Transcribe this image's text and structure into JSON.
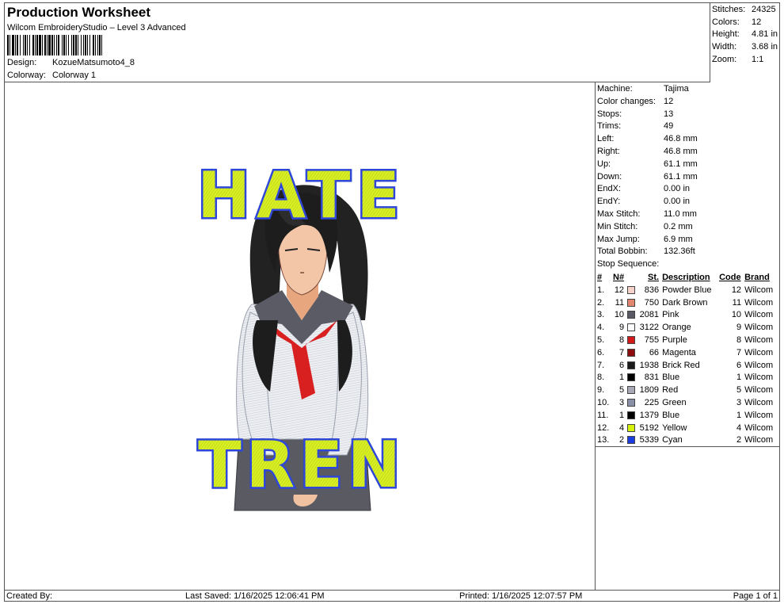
{
  "header": {
    "title": "Production Worksheet",
    "subtitle": "Wilcom EmbroideryStudio – Level 3 Advanced",
    "design_label": "Design:",
    "design_value": "KozueMatsumoto4_8",
    "colorway_label": "Colorway:",
    "colorway_value": "Colorway 1"
  },
  "topstats": [
    {
      "k": "Stitches:",
      "v": "24325"
    },
    {
      "k": "Colors:",
      "v": "12"
    },
    {
      "k": "Height:",
      "v": "4.81 in"
    },
    {
      "k": "Width:",
      "v": "3.68 in"
    },
    {
      "k": "Zoom:",
      "v": "1:1"
    }
  ],
  "design_text": {
    "top": "HATE",
    "bottom": "TREN"
  },
  "info": [
    {
      "k": "Machine:",
      "v": "Tajima"
    },
    {
      "k": "Color changes:",
      "v": "12"
    },
    {
      "k": "Stops:",
      "v": "13"
    },
    {
      "k": "Trims:",
      "v": "49"
    },
    {
      "k": "Left:",
      "v": "46.8 mm"
    },
    {
      "k": "Right:",
      "v": "46.8 mm"
    },
    {
      "k": "Up:",
      "v": "61.1 mm"
    },
    {
      "k": "Down:",
      "v": "61.1 mm"
    },
    {
      "k": "EndX:",
      "v": "0.00 in"
    },
    {
      "k": "EndY:",
      "v": "0.00 in"
    },
    {
      "k": "Max Stitch:",
      "v": "11.0 mm"
    },
    {
      "k": "Min Stitch:",
      "v": "0.2 mm"
    },
    {
      "k": "Max Jump:",
      "v": "6.9 mm"
    },
    {
      "k": "Total Bobbin:",
      "v": "132.36ft"
    }
  ],
  "sequence": {
    "title": "Stop Sequence:",
    "headers": [
      "#",
      "N#",
      "St.",
      "Description",
      "Code",
      "Brand"
    ],
    "rows": [
      {
        "i": "1.",
        "n": "12",
        "color": "#f6d2c8",
        "st": "836",
        "desc": "Powder Blue",
        "code": "12",
        "brand": "Wilcom"
      },
      {
        "i": "2.",
        "n": "11",
        "color": "#e38670",
        "st": "750",
        "desc": "Dark Brown",
        "code": "11",
        "brand": "Wilcom"
      },
      {
        "i": "3.",
        "n": "10",
        "color": "#595964",
        "st": "2081",
        "desc": "Pink",
        "code": "10",
        "brand": "Wilcom"
      },
      {
        "i": "4.",
        "n": "9",
        "color": "#ffffff",
        "st": "3122",
        "desc": "Orange",
        "code": "9",
        "brand": "Wilcom"
      },
      {
        "i": "5.",
        "n": "8",
        "color": "#d31919",
        "st": "755",
        "desc": "Purple",
        "code": "8",
        "brand": "Wilcom"
      },
      {
        "i": "6.",
        "n": "7",
        "color": "#8c0c0c",
        "st": "66",
        "desc": "Magenta",
        "code": "7",
        "brand": "Wilcom"
      },
      {
        "i": "7.",
        "n": "6",
        "color": "#1a1a1a",
        "st": "1938",
        "desc": "Brick Red",
        "code": "6",
        "brand": "Wilcom"
      },
      {
        "i": "8.",
        "n": "1",
        "color": "#000000",
        "st": "831",
        "desc": "Blue",
        "code": "1",
        "brand": "Wilcom"
      },
      {
        "i": "9.",
        "n": "5",
        "color": "#a8a8b6",
        "st": "1809",
        "desc": "Red",
        "code": "5",
        "brand": "Wilcom"
      },
      {
        "i": "10.",
        "n": "3",
        "color": "#8a90a8",
        "st": "225",
        "desc": "Green",
        "code": "3",
        "brand": "Wilcom"
      },
      {
        "i": "11.",
        "n": "1",
        "color": "#000000",
        "st": "1379",
        "desc": "Blue",
        "code": "1",
        "brand": "Wilcom"
      },
      {
        "i": "12.",
        "n": "4",
        "color": "#d7f20a",
        "st": "5192",
        "desc": "Yellow",
        "code": "4",
        "brand": "Wilcom"
      },
      {
        "i": "13.",
        "n": "2",
        "color": "#1c3ee0",
        "st": "5339",
        "desc": "Cyan",
        "code": "2",
        "brand": "Wilcom"
      }
    ]
  },
  "footer": {
    "created": "Created By:",
    "saved": "Last Saved: 1/16/2025 12:06:41 PM",
    "printed": "Printed: 1/16/2025 12:07:57 PM",
    "page": "Page 1 of 1"
  }
}
